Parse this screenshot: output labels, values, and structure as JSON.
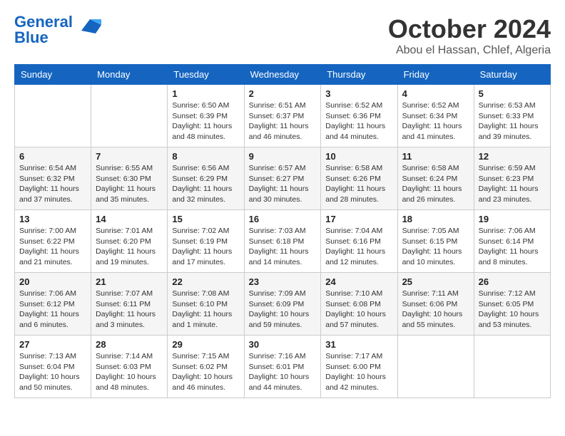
{
  "header": {
    "logo_line1": "General",
    "logo_line2": "Blue",
    "month": "October 2024",
    "location": "Abou el Hassan, Chlef, Algeria"
  },
  "weekdays": [
    "Sunday",
    "Monday",
    "Tuesday",
    "Wednesday",
    "Thursday",
    "Friday",
    "Saturday"
  ],
  "weeks": [
    [
      {
        "day": "",
        "sunrise": "",
        "sunset": "",
        "daylight": ""
      },
      {
        "day": "",
        "sunrise": "",
        "sunset": "",
        "daylight": ""
      },
      {
        "day": "1",
        "sunrise": "Sunrise: 6:50 AM",
        "sunset": "Sunset: 6:39 PM",
        "daylight": "Daylight: 11 hours and 48 minutes."
      },
      {
        "day": "2",
        "sunrise": "Sunrise: 6:51 AM",
        "sunset": "Sunset: 6:37 PM",
        "daylight": "Daylight: 11 hours and 46 minutes."
      },
      {
        "day": "3",
        "sunrise": "Sunrise: 6:52 AM",
        "sunset": "Sunset: 6:36 PM",
        "daylight": "Daylight: 11 hours and 44 minutes."
      },
      {
        "day": "4",
        "sunrise": "Sunrise: 6:52 AM",
        "sunset": "Sunset: 6:34 PM",
        "daylight": "Daylight: 11 hours and 41 minutes."
      },
      {
        "day": "5",
        "sunrise": "Sunrise: 6:53 AM",
        "sunset": "Sunset: 6:33 PM",
        "daylight": "Daylight: 11 hours and 39 minutes."
      }
    ],
    [
      {
        "day": "6",
        "sunrise": "Sunrise: 6:54 AM",
        "sunset": "Sunset: 6:32 PM",
        "daylight": "Daylight: 11 hours and 37 minutes."
      },
      {
        "day": "7",
        "sunrise": "Sunrise: 6:55 AM",
        "sunset": "Sunset: 6:30 PM",
        "daylight": "Daylight: 11 hours and 35 minutes."
      },
      {
        "day": "8",
        "sunrise": "Sunrise: 6:56 AM",
        "sunset": "Sunset: 6:29 PM",
        "daylight": "Daylight: 11 hours and 32 minutes."
      },
      {
        "day": "9",
        "sunrise": "Sunrise: 6:57 AM",
        "sunset": "Sunset: 6:27 PM",
        "daylight": "Daylight: 11 hours and 30 minutes."
      },
      {
        "day": "10",
        "sunrise": "Sunrise: 6:58 AM",
        "sunset": "Sunset: 6:26 PM",
        "daylight": "Daylight: 11 hours and 28 minutes."
      },
      {
        "day": "11",
        "sunrise": "Sunrise: 6:58 AM",
        "sunset": "Sunset: 6:24 PM",
        "daylight": "Daylight: 11 hours and 26 minutes."
      },
      {
        "day": "12",
        "sunrise": "Sunrise: 6:59 AM",
        "sunset": "Sunset: 6:23 PM",
        "daylight": "Daylight: 11 hours and 23 minutes."
      }
    ],
    [
      {
        "day": "13",
        "sunrise": "Sunrise: 7:00 AM",
        "sunset": "Sunset: 6:22 PM",
        "daylight": "Daylight: 11 hours and 21 minutes."
      },
      {
        "day": "14",
        "sunrise": "Sunrise: 7:01 AM",
        "sunset": "Sunset: 6:20 PM",
        "daylight": "Daylight: 11 hours and 19 minutes."
      },
      {
        "day": "15",
        "sunrise": "Sunrise: 7:02 AM",
        "sunset": "Sunset: 6:19 PM",
        "daylight": "Daylight: 11 hours and 17 minutes."
      },
      {
        "day": "16",
        "sunrise": "Sunrise: 7:03 AM",
        "sunset": "Sunset: 6:18 PM",
        "daylight": "Daylight: 11 hours and 14 minutes."
      },
      {
        "day": "17",
        "sunrise": "Sunrise: 7:04 AM",
        "sunset": "Sunset: 6:16 PM",
        "daylight": "Daylight: 11 hours and 12 minutes."
      },
      {
        "day": "18",
        "sunrise": "Sunrise: 7:05 AM",
        "sunset": "Sunset: 6:15 PM",
        "daylight": "Daylight: 11 hours and 10 minutes."
      },
      {
        "day": "19",
        "sunrise": "Sunrise: 7:06 AM",
        "sunset": "Sunset: 6:14 PM",
        "daylight": "Daylight: 11 hours and 8 minutes."
      }
    ],
    [
      {
        "day": "20",
        "sunrise": "Sunrise: 7:06 AM",
        "sunset": "Sunset: 6:12 PM",
        "daylight": "Daylight: 11 hours and 6 minutes."
      },
      {
        "day": "21",
        "sunrise": "Sunrise: 7:07 AM",
        "sunset": "Sunset: 6:11 PM",
        "daylight": "Daylight: 11 hours and 3 minutes."
      },
      {
        "day": "22",
        "sunrise": "Sunrise: 7:08 AM",
        "sunset": "Sunset: 6:10 PM",
        "daylight": "Daylight: 11 hours and 1 minute."
      },
      {
        "day": "23",
        "sunrise": "Sunrise: 7:09 AM",
        "sunset": "Sunset: 6:09 PM",
        "daylight": "Daylight: 10 hours and 59 minutes."
      },
      {
        "day": "24",
        "sunrise": "Sunrise: 7:10 AM",
        "sunset": "Sunset: 6:08 PM",
        "daylight": "Daylight: 10 hours and 57 minutes."
      },
      {
        "day": "25",
        "sunrise": "Sunrise: 7:11 AM",
        "sunset": "Sunset: 6:06 PM",
        "daylight": "Daylight: 10 hours and 55 minutes."
      },
      {
        "day": "26",
        "sunrise": "Sunrise: 7:12 AM",
        "sunset": "Sunset: 6:05 PM",
        "daylight": "Daylight: 10 hours and 53 minutes."
      }
    ],
    [
      {
        "day": "27",
        "sunrise": "Sunrise: 7:13 AM",
        "sunset": "Sunset: 6:04 PM",
        "daylight": "Daylight: 10 hours and 50 minutes."
      },
      {
        "day": "28",
        "sunrise": "Sunrise: 7:14 AM",
        "sunset": "Sunset: 6:03 PM",
        "daylight": "Daylight: 10 hours and 48 minutes."
      },
      {
        "day": "29",
        "sunrise": "Sunrise: 7:15 AM",
        "sunset": "Sunset: 6:02 PM",
        "daylight": "Daylight: 10 hours and 46 minutes."
      },
      {
        "day": "30",
        "sunrise": "Sunrise: 7:16 AM",
        "sunset": "Sunset: 6:01 PM",
        "daylight": "Daylight: 10 hours and 44 minutes."
      },
      {
        "day": "31",
        "sunrise": "Sunrise: 7:17 AM",
        "sunset": "Sunset: 6:00 PM",
        "daylight": "Daylight: 10 hours and 42 minutes."
      },
      {
        "day": "",
        "sunrise": "",
        "sunset": "",
        "daylight": ""
      },
      {
        "day": "",
        "sunrise": "",
        "sunset": "",
        "daylight": ""
      }
    ]
  ]
}
